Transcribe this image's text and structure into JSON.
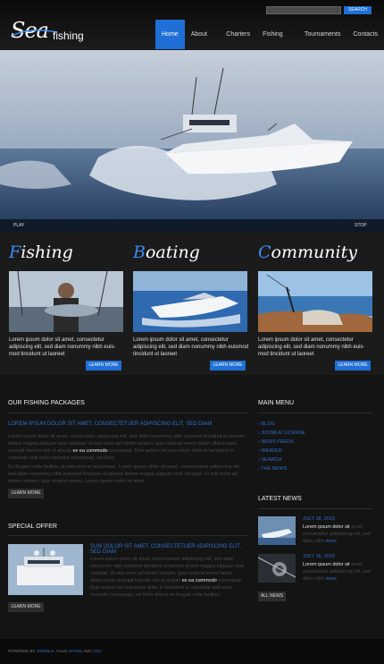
{
  "search": {
    "placeholder": "",
    "button_label": "SEARCH"
  },
  "logo": {
    "sea": "Sea",
    "fishing": "fishing"
  },
  "nav": {
    "items": [
      "Home",
      "About us",
      "Charters",
      "Fishing tips",
      "Tournaments",
      "Contacts"
    ],
    "active_index": 0
  },
  "hero": {
    "play_label": "PLAY",
    "stop_label": "STOP"
  },
  "features": [
    {
      "title_first": "F",
      "title_rest": "ishing",
      "text": "Lorem ipsum dolor sit amet, consectetur adipiscing elit, sed diam nonummy nibh euis-mod tincidunt ut laoreet",
      "button": "LEARN MORE"
    },
    {
      "title_first": "B",
      "title_rest": "oating",
      "text": "Lorem ipsum dolor sit amet, consectetur adipiscing elit, sed diam nonummy nibh euismod tincidunt ut laoreet",
      "button": "LEARN MORE"
    },
    {
      "title_first": "C",
      "title_rest": "ommunity",
      "text": "Lorem ipsum dolor sit amet, consectetur adipiscing elit, sed diam nonummy nibh euis-mod tincidunt ut laoreet",
      "button": "LEARN MORE"
    }
  ],
  "packages": {
    "title": "OUR FISHING PACKAGES",
    "subhead": "LOREM IPSUM DOLOR SIT AMET, CONSECTETUER ADIPISCING ELIT, SED DIAM",
    "para1_a": "Lorem ipsum dolor sit amet, consectetur adipiscing elit, sed diam nonummy nibh euismod tincidunt ut laoreet dolore magna aliquam erat volutpat. Ut wisi enim ad minim veniam, quis nostrud exerci tation ullamcorper suscipit lobortis nisl ut aliquip",
    "para1_link": "ex ea commodo",
    "para1_b": "consequat. Duis autem vel eum iriure dolor in hendrerit in vulputate velit esse molestie consequat, vel illum.",
    "para2": "Eu feugiat nulla facilisis at vero eros et accumsan. Lorem ipsum dolor sit amet, consectetuer adipiscing elit, sed diam nonummy nibh euismod tincidunt ut laoreet dolore magna aliquam erat volutpat. Ut wisi enim ad minim veniam, quis nostrud exerci. Lorem ipsum dolor sit amet.",
    "button": "LEARN MORE"
  },
  "special": {
    "title": "SPECIAL OFFER",
    "subhead": "SUM DOLOR SIT AMET, CONSECTETUER ADIPISCING ELIT, SED DIAM",
    "text_a": "Lorem ipsum dolor sit amet, consectetuer adipiscing elit, sed diam nonummy nibh euismod tincidunt ut laoreet dolore magna aliquam erat volutpat. Ut wisi enim ad minim veniam, quis nostrud exerci tation ullamcorper suscipit lobortis nisl ut aliquip",
    "text_link": "ex ea commodo",
    "text_b": "consequat. Duis autem vel eum iriure dolor in hendrerit in vulputate velit esse molestie consequat, vel illum dolore eu feugiat nulla facilisis.",
    "button": "LEARN MORE"
  },
  "main_menu": {
    "title": "MAIN MENU",
    "items": [
      "BLOG",
      "JOOMLA! LICENSE",
      "NEWS FEEDS",
      "WEAVER",
      "SEARCH",
      "THE NEWS"
    ]
  },
  "latest_news": {
    "title": "LATEST NEWS",
    "items": [
      {
        "date": "JULY 18, 2010",
        "text_a": "Lorem ipsum dolor sit",
        "text_b": "amet, consectetur adipisicing elit, sed diam nibh",
        "more": "more"
      },
      {
        "date": "JULY 18, 2010",
        "text_a": "Lorem ipsum dolor sit",
        "text_b": "amet, consectetur adipisicing elit, sed diam nibh",
        "more": "more"
      }
    ],
    "all_button": "ALL NEWS"
  },
  "footer": {
    "prefix": "POWERED BY",
    "joomla": "JOOMLA!",
    "valid": "VALID",
    "xhtml": "XHTML",
    "and": "AND",
    "css": "CSS"
  },
  "colors": {
    "accent": "#1f6fd6",
    "background": "#141414",
    "link": "#2f6fc8"
  }
}
